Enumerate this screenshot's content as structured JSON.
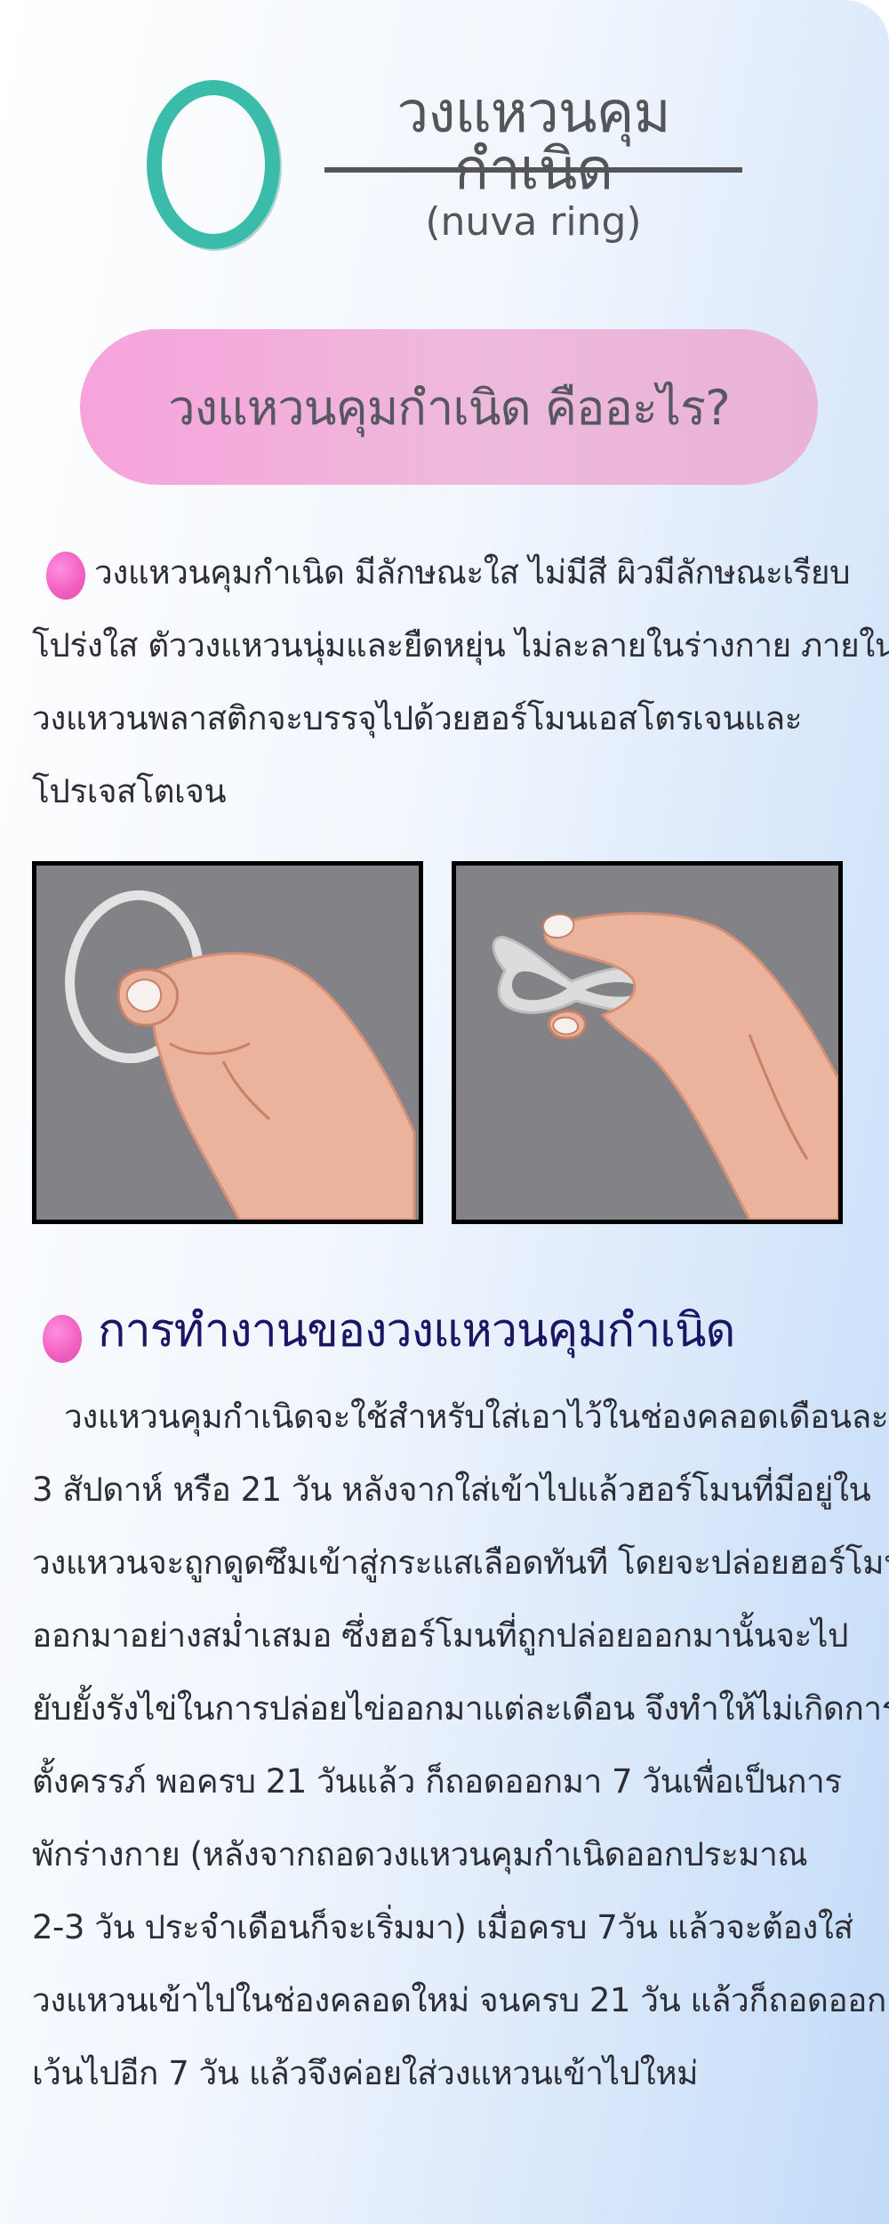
{
  "header": {
    "title": "วงแหวนคุมกำเนิด",
    "subtitle": "(nuva ring)"
  },
  "banner": {
    "text": "วงแหวนคุมกำเนิด คืออะไร?"
  },
  "intro": {
    "lines": [
      "วงแหวนคุมกำเนิด มีลักษณะใส ไม่มีสี ผิวมีลักษณะเรียบ",
      "โปร่งใส ตัววงแหวนนุ่มและยืดหยุ่น ไม่ละลายในร่างกาย ภายใน",
      "วงแหวนพลาสติกจะบรรจุไปด้วยฮอร์โมนเอสโตรเจนและ",
      "โปรเจสโตเจน"
    ]
  },
  "section2": {
    "heading": "การทำงานของวงแหวนคุมกำเนิด",
    "lines": [
      "วงแหวนคุมกำเนิดจะใช้สำหรับใส่เอาไว้ในช่องคลอดเดือนละ",
      "3 สัปดาห์ หรือ 21 วัน หลังจากใส่เข้าไปแล้วฮอร์โมนที่มีอยู่ใน",
      "วงแหวนจะถูกดูดซึมเข้าสู่กระแสเลือดทันที โดยจะปล่อยฮอร์โมน",
      "ออกมาอย่างสม่ำเสมอ ซึ่งฮอร์โมนที่ถูกปล่อยออกมานั้นจะไป",
      "ยับยั้งรังไข่ในการปล่อยไข่ออกมาแต่ละเดือน จึงทำให้ไม่เกิดการ",
      "ตั้งครรภ์ พอครบ 21 วันแล้ว ก็ถอดออกมา 7 วันเพื่อเป็นการ",
      "พักร่างกาย (หลังจากถอดวงแหวนคุมกำเนิดออกประมาณ",
      "2-3 วัน ประจำเดือนก็จะเริ่มมา) เมื่อครบ 7วัน แล้วจะต้องใส่",
      "วงแหวนเข้าไปในช่องคลอดใหม่ จนครบ 21 วัน แล้วก็ถอดออก",
      "เว้นไปอีก 7 วัน แล้วจึงค่อยใส่วงแหวนเข้าไปใหม่"
    ]
  },
  "colors": {
    "ring": "#3bbcab",
    "bullet": "#f05fbe",
    "heading": "#1b1566",
    "banner": "#f2a9dc"
  },
  "images": [
    {
      "name": "hand-holding-ring-illustration"
    },
    {
      "name": "hand-squeezing-ring-illustration"
    }
  ]
}
